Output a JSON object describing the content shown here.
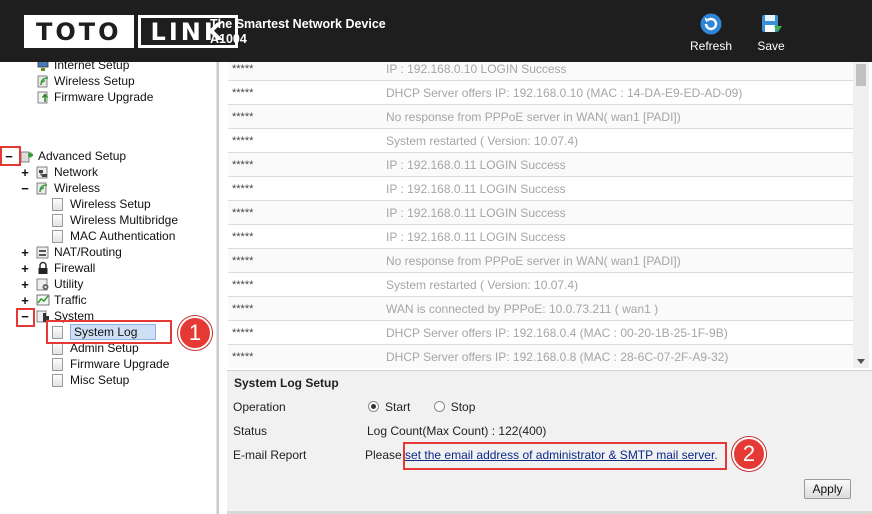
{
  "header": {
    "logo_part1": "TOTO",
    "logo_part2": "LINK",
    "tagline": "The Smartest Network Device",
    "model": "A1004",
    "refresh_label": "Refresh",
    "save_label": "Save"
  },
  "tree": {
    "top_items": [
      "Internet Setup",
      "Wireless Setup",
      "Firmware Upgrade"
    ],
    "advanced_setup": "Advanced Setup",
    "network": "Network",
    "wireless": "Wireless",
    "wireless_children": [
      "Wireless Setup",
      "Wireless Multibridge",
      "MAC Authentication"
    ],
    "nat_routing": "NAT/Routing",
    "firewall": "Firewall",
    "utility": "Utility",
    "traffic": "Traffic",
    "system": "System",
    "system_children": [
      "System Log",
      "Admin Setup",
      "Firmware Upgrade",
      "Misc Setup"
    ],
    "expand_symbol": "+",
    "collapse_symbol": "−"
  },
  "annotations": {
    "badge1": "1",
    "badge2": "2",
    "highlight_color": "#e53935"
  },
  "log": {
    "rows": [
      {
        "user": "*****",
        "message": "IP : 192.168.0.10 LOGIN Success"
      },
      {
        "user": "*****",
        "message": "DHCP Server offers IP: 192.168.0.10 (MAC : 14-DA-E9-ED-AD-09)"
      },
      {
        "user": "*****",
        "message": "No response from PPPoE server in WAN( wan1 [PADI])"
      },
      {
        "user": "*****",
        "message": "System restarted ( Version: 10.07.4)"
      },
      {
        "user": "*****",
        "message": "IP : 192.168.0.11 LOGIN Success"
      },
      {
        "user": "*****",
        "message": "IP : 192.168.0.11 LOGIN Success"
      },
      {
        "user": "*****",
        "message": "IP : 192.168.0.11 LOGIN Success"
      },
      {
        "user": "*****",
        "message": "IP : 192.168.0.11 LOGIN Success"
      },
      {
        "user": "*****",
        "message": "No response from PPPoE server in WAN( wan1 [PADI])"
      },
      {
        "user": "*****",
        "message": "System restarted ( Version: 10.07.4)"
      },
      {
        "user": "*****",
        "message": "WAN is connected by PPPoE: 10.0.73.211 ( wan1 )"
      },
      {
        "user": "*****",
        "message": "DHCP Server offers IP: 192.168.0.4 (MAC : 00-20-1B-25-1F-9B)"
      },
      {
        "user": "*****",
        "message": "DHCP Server offers IP: 192.168.0.8 (MAC : 28-6C-07-2F-A9-32)"
      }
    ]
  },
  "setup": {
    "title": "System Log Setup",
    "operation_label": "Operation",
    "start_label": "Start",
    "stop_label": "Stop",
    "operation_value": "Start",
    "status_label": "Status",
    "status_value": "Log Count(Max Count) : 122(400)",
    "email_label": "E-mail Report",
    "email_prefix": "Please",
    "email_link": "set the email address of administrator & SMTP mail server",
    "email_suffix": ".",
    "apply_label": "Apply"
  }
}
